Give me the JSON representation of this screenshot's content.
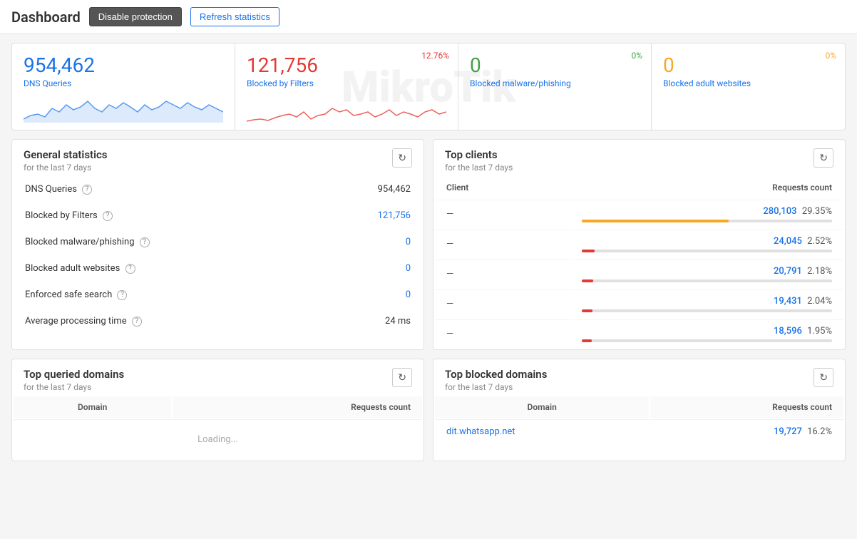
{
  "header": {
    "title": "Dashboard",
    "disable_btn": "Disable protection",
    "refresh_btn": "Refresh statistics"
  },
  "top_stats": [
    {
      "number": "954,462",
      "number_class": "blue",
      "label": "DNS Queries",
      "percent": null,
      "percent_class": ""
    },
    {
      "number": "121,756",
      "number_class": "red",
      "label": "Blocked by Filters",
      "percent": "12.76%",
      "percent_class": "red"
    },
    {
      "number": "0",
      "number_class": "green",
      "label": "Blocked malware/phishing",
      "percent": "0%",
      "percent_class": "green"
    },
    {
      "number": "0",
      "number_class": "yellow",
      "label": "Blocked adult websites",
      "percent": "0%",
      "percent_class": "yellow"
    }
  ],
  "general_stats": {
    "title": "General statistics",
    "subtitle": "for the last 7 days",
    "rows": [
      {
        "label": "DNS Queries",
        "value": "954,462",
        "value_class": "black"
      },
      {
        "label": "Blocked by Filters",
        "value": "121,756",
        "value_class": "blue"
      },
      {
        "label": "Blocked malware/phishing",
        "value": "0",
        "value_class": "blue"
      },
      {
        "label": "Blocked adult websites",
        "value": "0",
        "value_class": "blue"
      },
      {
        "label": "Enforced safe search",
        "value": "0",
        "value_class": "blue"
      },
      {
        "label": "Average processing time",
        "value": "24 ms",
        "value_class": "black"
      }
    ]
  },
  "top_clients": {
    "title": "Top clients",
    "subtitle": "for the last 7 days",
    "col_client": "Client",
    "col_requests": "Requests count",
    "rows": [
      {
        "client": "",
        "count": "280,103",
        "pct": "29.35%",
        "bar_pct": 29.35,
        "bar_class": "bar-gold"
      },
      {
        "client": "",
        "count": "24,045",
        "pct": "2.52%",
        "bar_pct": 2.52,
        "bar_class": "bar-red"
      },
      {
        "client": "",
        "count": "20,791",
        "pct": "2.18%",
        "bar_pct": 2.18,
        "bar_class": "bar-red"
      },
      {
        "client": "",
        "count": "19,431",
        "pct": "2.04%",
        "bar_pct": 2.04,
        "bar_class": "bar-red"
      },
      {
        "client": "",
        "count": "18,596",
        "pct": "1.95%",
        "bar_pct": 1.95,
        "bar_class": "bar-red"
      }
    ]
  },
  "top_queried_domains": {
    "title": "Top queried domains",
    "subtitle": "for the last 7 days",
    "col_domain": "Domain",
    "col_requests": "Requests count"
  },
  "top_blocked_domains": {
    "title": "Top blocked domains",
    "subtitle": "for the last 7 days",
    "col_domain": "Domain",
    "col_requests": "Requests count",
    "rows": [
      {
        "domain": "dit.whatsapp.net",
        "count": "19,727",
        "pct": "16.2%"
      }
    ]
  }
}
